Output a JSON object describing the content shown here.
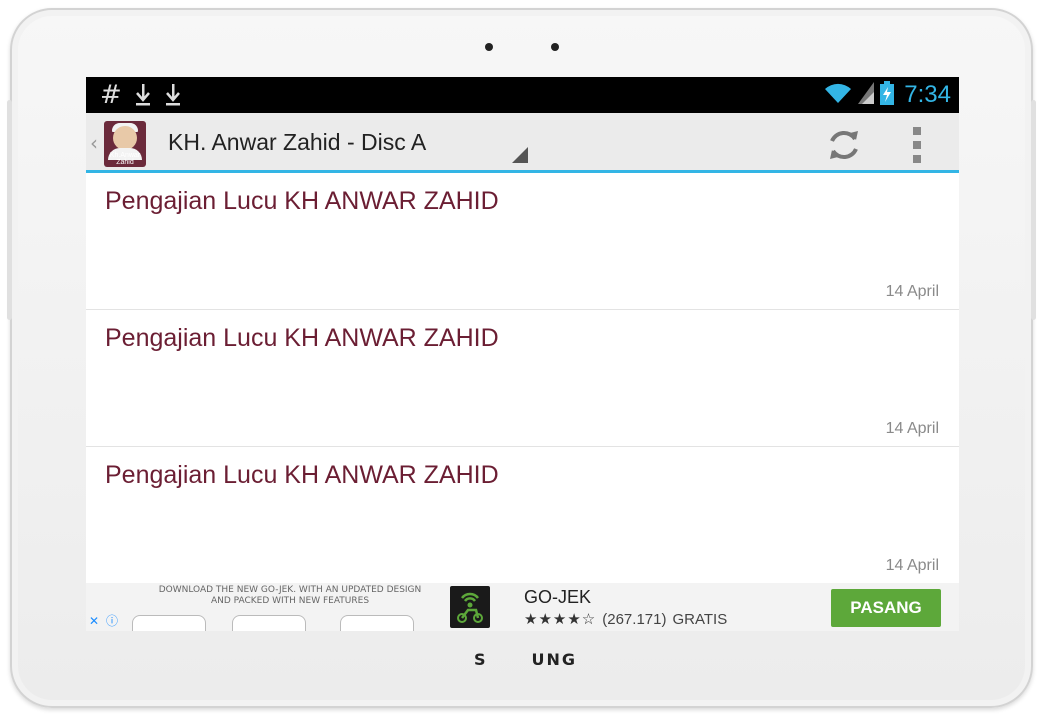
{
  "status_bar": {
    "notification_icons": [
      "hash-icon",
      "download-icon",
      "download-icon"
    ],
    "signal_icons": [
      "wifi-icon",
      "cell-signal-icon",
      "battery-charging-icon"
    ],
    "time": "7:34",
    "accent_color": "#33b5e5"
  },
  "action_bar": {
    "app_icon_text": "Kh.Anwar Zahid",
    "title": "KH. Anwar Zahid - Disc A",
    "actions": [
      "refresh-icon",
      "overflow-menu-icon"
    ]
  },
  "list": {
    "items": [
      {
        "title": "Pengajian Lucu KH ANWAR ZAHID",
        "date": "14 April"
      },
      {
        "title": "Pengajian Lucu KH ANWAR ZAHID",
        "date": "14 April"
      },
      {
        "title": "Pengajian Lucu KH ANWAR ZAHID",
        "date": "14 April"
      }
    ],
    "title_color": "#6b1e33"
  },
  "ad": {
    "promo_line1": "DOWNLOAD THE NEW GO-JEK. WITH AN UPDATED DESIGN",
    "promo_line2": "AND PACKED WITH NEW FEATURES",
    "app_name": "GO-JEK",
    "stars": "★★★★☆",
    "rating_count": "(267.171)",
    "price": "GRATIS",
    "install_label": "PASANG",
    "install_color": "#5da83a"
  },
  "device": {
    "brand_left": "S",
    "brand_right": "UNG"
  }
}
